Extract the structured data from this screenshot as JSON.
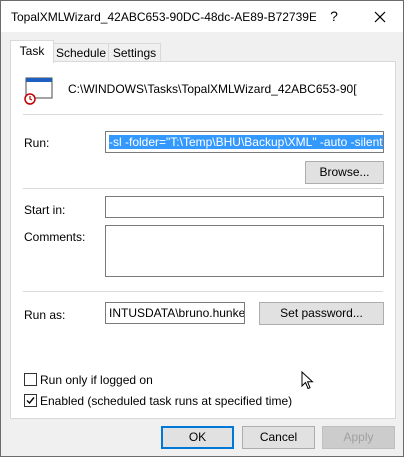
{
  "window": {
    "title": "TopalXMLWizard_42ABC653-90DC-48dc-AE89-B72739E...",
    "help_glyph": "?",
    "close_glyph": "✕"
  },
  "tabs": [
    {
      "label": "Task",
      "active": true
    },
    {
      "label": "Schedule",
      "active": false
    },
    {
      "label": "Settings",
      "active": false
    }
  ],
  "task": {
    "path": "C:\\WINDOWS\\Tasks\\TopalXMLWizard_42ABC653-90[",
    "icon": "scheduled-task-icon"
  },
  "run": {
    "label": "Run:",
    "value": "-sl -folder=\"T:\\Temp\\BHU\\Backup\\XML\" -auto -silent -zip",
    "browse_label": "Browse..."
  },
  "start_in": {
    "label": "Start in:",
    "value": ""
  },
  "comments": {
    "label": "Comments:",
    "value": ""
  },
  "run_as": {
    "label": "Run as:",
    "value": "INTUSDATA\\bruno.hunkele",
    "set_password_label": "Set password..."
  },
  "options": {
    "run_only_logged_on": {
      "label": "Run only if logged on",
      "checked": false
    },
    "enabled": {
      "label": "Enabled (scheduled task runs at specified time)",
      "checked": true
    }
  },
  "footer": {
    "ok_label": "OK",
    "cancel_label": "Cancel",
    "apply_label": "Apply"
  },
  "colors": {
    "selection": "#3399ff",
    "default_button_border": "#0078d7",
    "window_background": "#f0f0f0"
  }
}
